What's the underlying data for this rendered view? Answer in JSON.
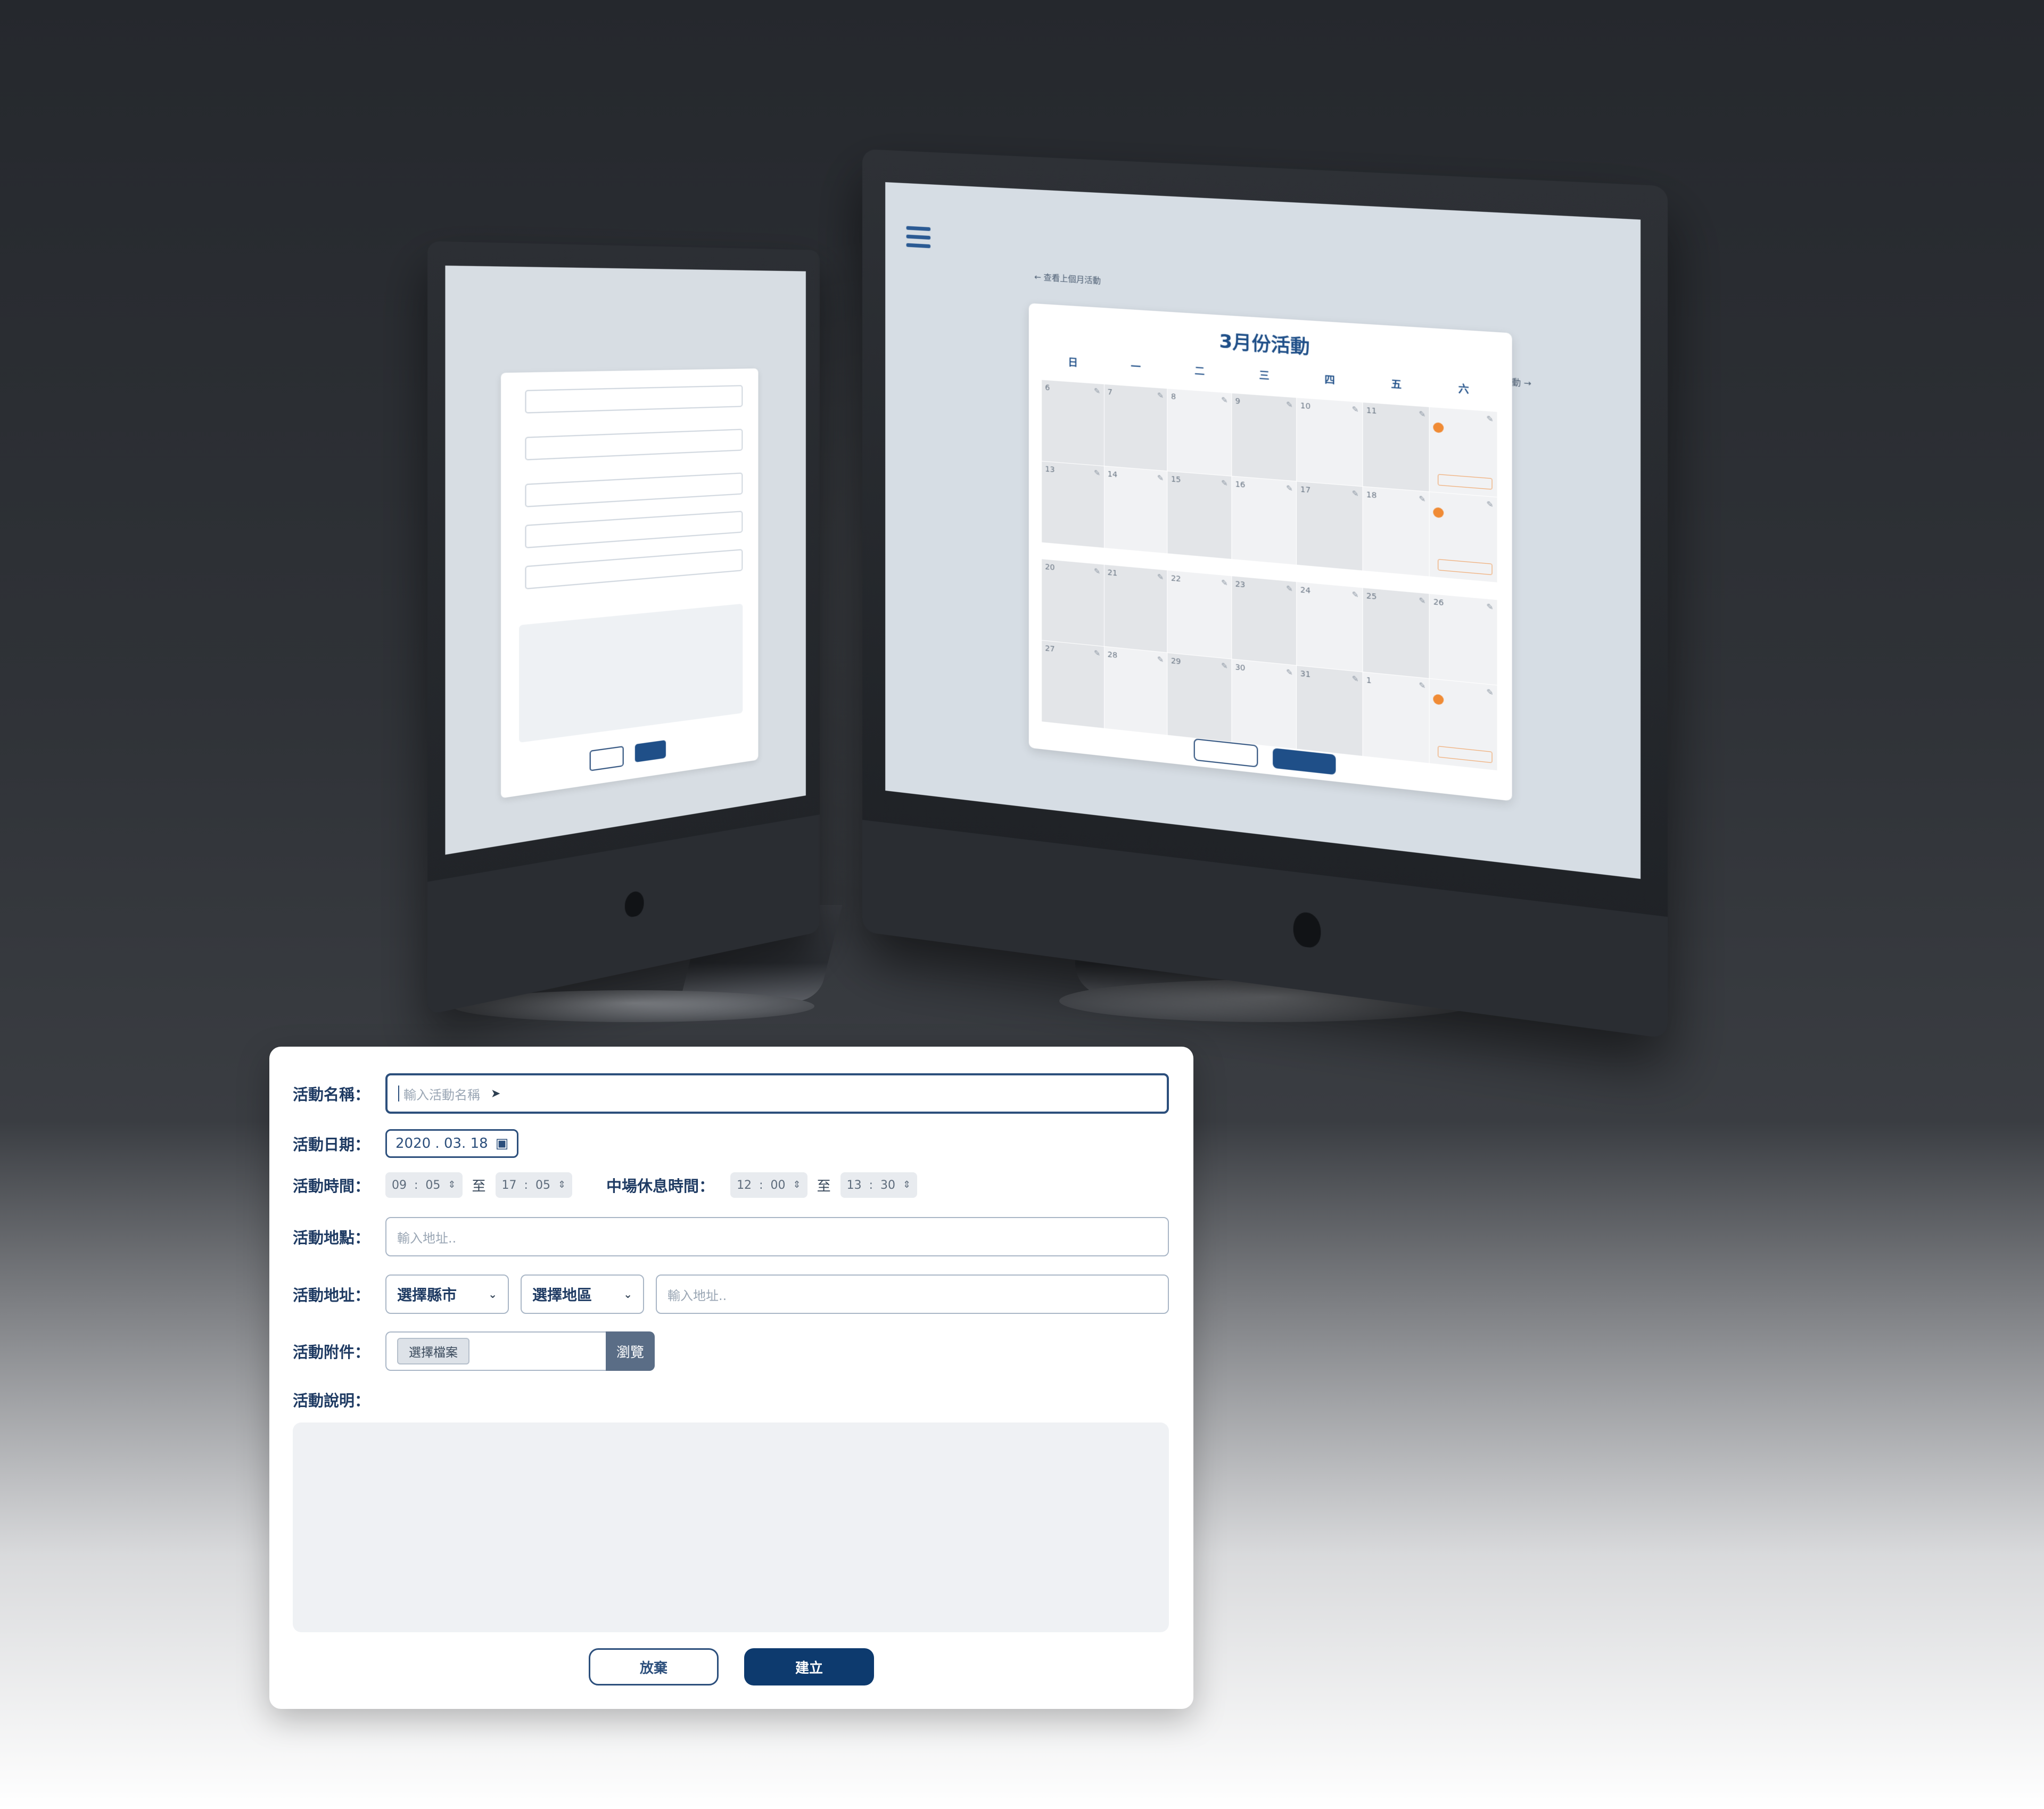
{
  "scene": {
    "big_screen": {
      "back_link": "← 查看上個月活動",
      "next_link": "查看下個月活動 →",
      "calendar_title": "3月份活動",
      "weekdays": [
        "日",
        "一",
        "二",
        "三",
        "四",
        "五",
        "六"
      ],
      "week1_days": [
        "6",
        "7",
        "8",
        "9",
        "10",
        "11",
        ""
      ],
      "week2_days": [
        "13",
        "14",
        "15",
        "16",
        "17",
        "18",
        ""
      ],
      "week3_days": [
        "20",
        "21",
        "22",
        "23",
        "24",
        "25",
        "26"
      ],
      "week4_days": [
        "27",
        "28",
        "29",
        "30",
        "31",
        "1",
        ""
      ]
    }
  },
  "form": {
    "name": {
      "label": "活動名稱：",
      "placeholder": "輸入活動名稱"
    },
    "date": {
      "label": "活動日期：",
      "value": "2020 . 03. 18"
    },
    "time": {
      "label": "活動時間：",
      "start_h": "09",
      "start_m": "05",
      "to": "至",
      "end_h": "17",
      "end_m": "05",
      "break_label": "中場休息時間：",
      "break_start_h": "12",
      "break_start_m": "00",
      "break_to": "至",
      "break_end_h": "13",
      "break_end_m": "30",
      "separator": ":"
    },
    "place": {
      "label": "活動地點：",
      "placeholder": "輸入地址.."
    },
    "address": {
      "label": "活動地址：",
      "city": "選擇縣市",
      "district": "選擇地區",
      "placeholder": "輸入地址.."
    },
    "attachment": {
      "label": "活動附件：",
      "choose": "選擇檔案",
      "browse": "瀏覽"
    },
    "description": {
      "label": "活動說明："
    },
    "buttons": {
      "discard": "放棄",
      "create": "建立"
    }
  }
}
